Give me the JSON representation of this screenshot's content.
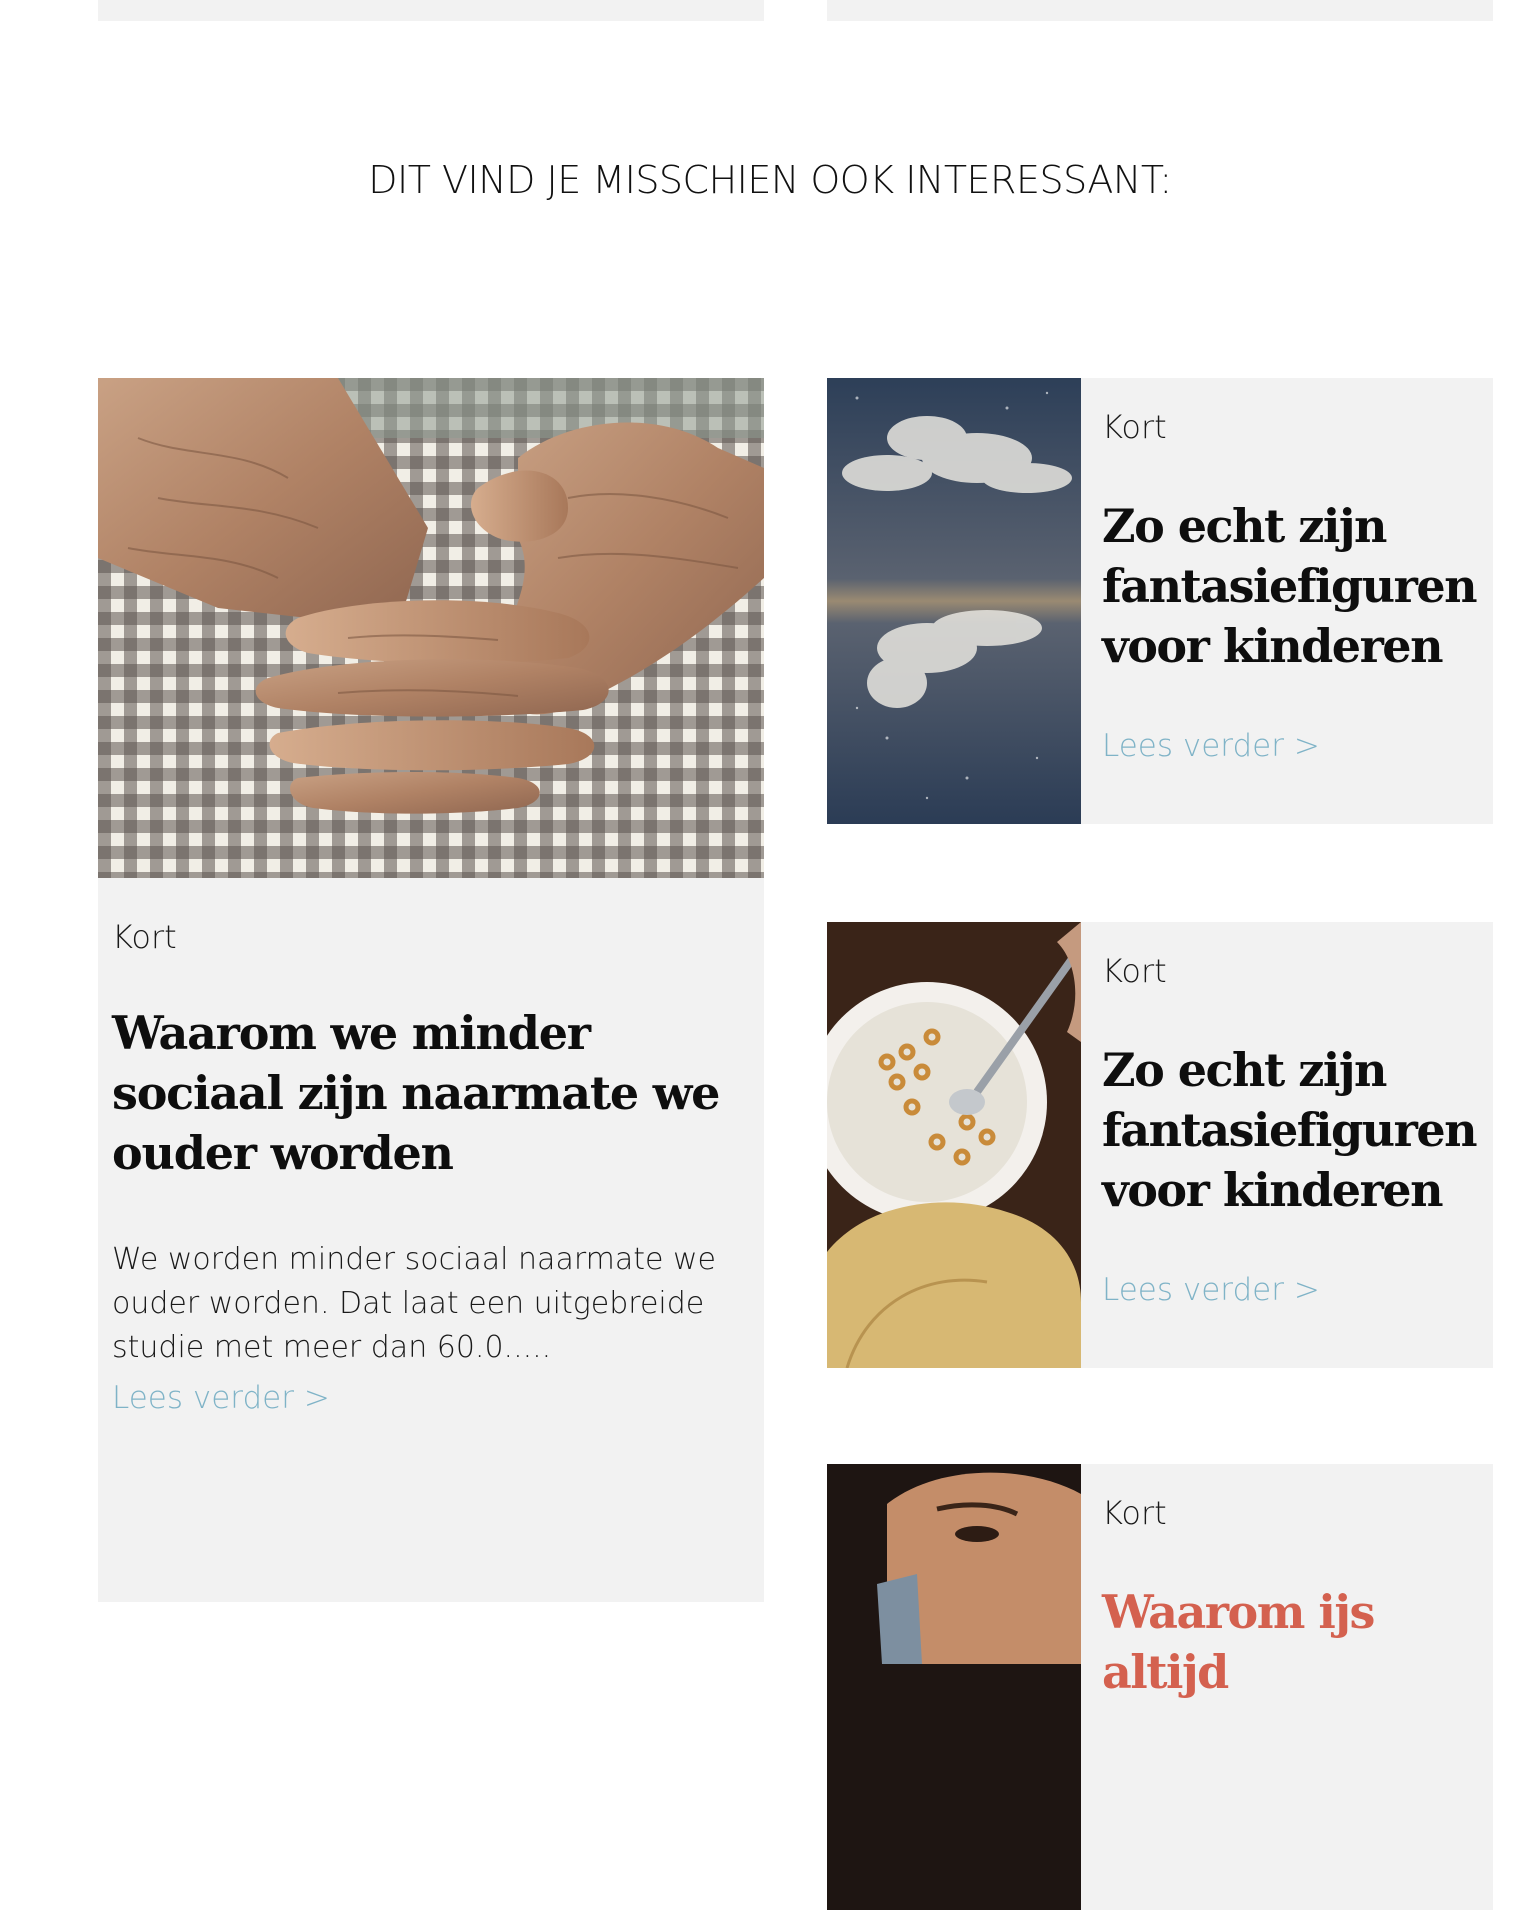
{
  "section": {
    "title": "DIT VIND JE MISSCHIEN OOK INTERESSANT:"
  },
  "featured": {
    "category": "Kort",
    "title": "Waarom we minder sociaal zijn naarmate we ouder worden",
    "excerpt": "We worden minder sociaal naarmate we ouder worden. Dat laat een uitgebreide studie met meer dan 60.0.....",
    "read_more": "Lees verder >",
    "image": "elderly-hands-on-gingham-photo"
  },
  "cards": [
    {
      "category": "Kort",
      "title": "Zo echt zijn fantasiefiguren voor kinderen",
      "read_more": "Lees verder >",
      "image": "clouds-reflection-night-sky-photo"
    },
    {
      "category": "Kort",
      "title": "Zo echt zijn fantasiefiguren voor kinderen",
      "read_more": "Lees verder >",
      "image": "child-cereal-bowl-photo"
    },
    {
      "category": "Kort",
      "title": "Waarom ijs altijd",
      "image": "woman-smiling-phone-photo"
    }
  ],
  "colors": {
    "card_background": "#f2f2f2",
    "link": "#7fb3c7",
    "accent_title": "#d4614f",
    "text": "#111111"
  }
}
